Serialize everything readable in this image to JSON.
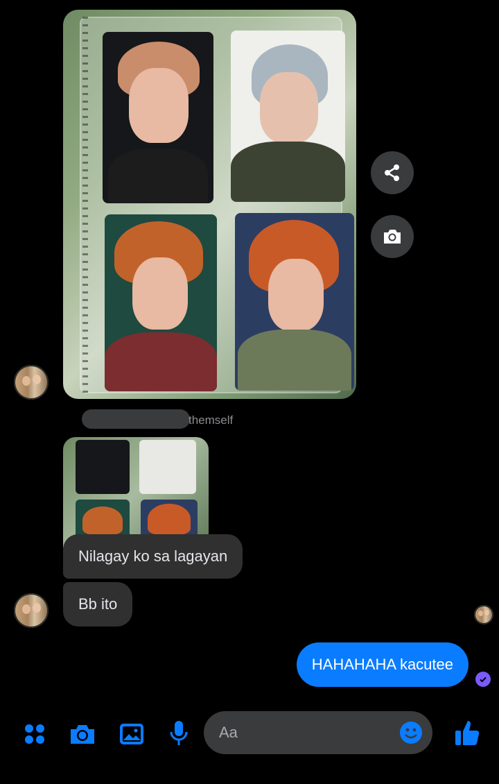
{
  "conversation": {
    "reply": {
      "suffix_text": "themself"
    },
    "messages": [
      {
        "id": "m1",
        "text": "Nilagay ko sa lagayan",
        "side": "incoming"
      },
      {
        "id": "m2",
        "text": "Bb ito",
        "side": "incoming"
      },
      {
        "id": "m3",
        "text": "HAHAHAHA kacutee",
        "side": "outgoing"
      }
    ]
  },
  "composer": {
    "placeholder": "Aa",
    "icons": [
      "apps-icon",
      "camera-icon",
      "gallery-icon",
      "microphone-icon",
      "emoji-icon",
      "thumbs-up-icon"
    ]
  },
  "side_actions": [
    "share-icon",
    "camera-icon"
  ],
  "colors": {
    "background": "#000000",
    "incoming_bubble": "#303030",
    "outgoing_bubble": "#0a7cff",
    "accent": "#0a7cff",
    "read_receipt": "#7a5af8"
  }
}
